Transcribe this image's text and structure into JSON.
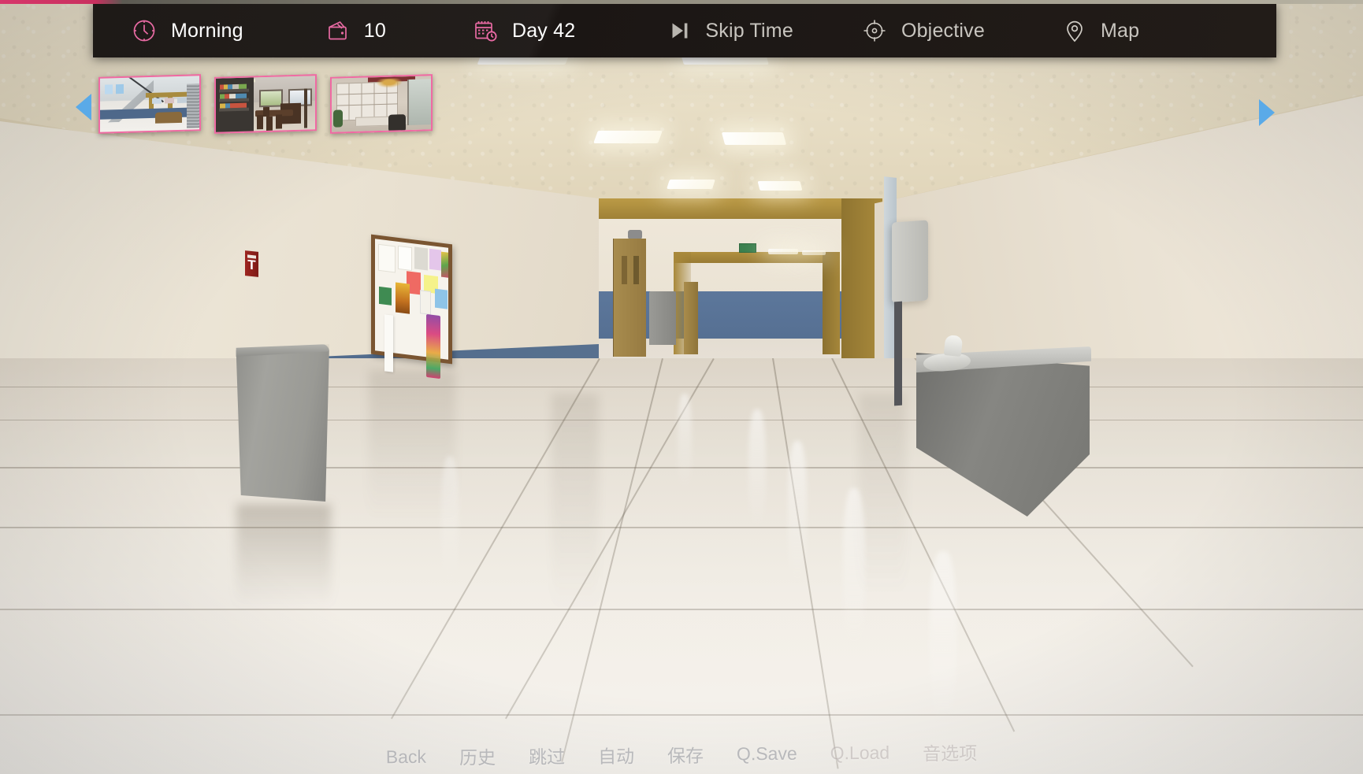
{
  "hud": {
    "items": [
      {
        "icon": "clock-icon",
        "name": "time-of-day",
        "label": "Morning",
        "style": "value"
      },
      {
        "icon": "wallet-icon",
        "name": "money",
        "label": "10",
        "style": "value"
      },
      {
        "icon": "calendar-icon",
        "name": "day-counter",
        "label": "Day 42",
        "style": "value"
      },
      {
        "icon": "skip-next-icon",
        "name": "skip-time",
        "label": "Skip Time",
        "style": "action"
      },
      {
        "icon": "crosshair-icon",
        "name": "objective",
        "label": "Objective",
        "style": "action"
      },
      {
        "icon": "map-pin-icon",
        "name": "map",
        "label": "Map",
        "style": "action"
      }
    ],
    "accent_color": "#e86aa3",
    "bar_color": "#1a1513",
    "text_color": "#f2f0ed"
  },
  "location_strip": {
    "prev_arrow_label": "◀",
    "next_arrow_label": "▶",
    "arrow_color": "#5aaae8",
    "border_color": "#f06aa3",
    "thumbnails": [
      {
        "name": "thumbnail-school-atrium",
        "alt": "School atrium with staircase"
      },
      {
        "name": "thumbnail-dining-room",
        "alt": "Dining room with table"
      },
      {
        "name": "thumbnail-study-office",
        "alt": "Study office with bookshelves"
      }
    ]
  },
  "bottom_menu": {
    "items": [
      {
        "name": "menu-back",
        "label": "Back"
      },
      {
        "name": "menu-history",
        "label": "历史"
      },
      {
        "name": "menu-skip",
        "label": "跳过"
      },
      {
        "name": "menu-auto",
        "label": "自动"
      },
      {
        "name": "menu-save",
        "label": "保存"
      },
      {
        "name": "menu-qsave",
        "label": "Q.Save"
      },
      {
        "name": "menu-qload",
        "label": "Q.Load"
      },
      {
        "name": "menu-options",
        "label": "音选项"
      }
    ]
  },
  "scene": {
    "name": "school-hallway",
    "description": "School corridor with blue wainscot, polished tile floor, bulletin board, trash can, water fountain"
  }
}
